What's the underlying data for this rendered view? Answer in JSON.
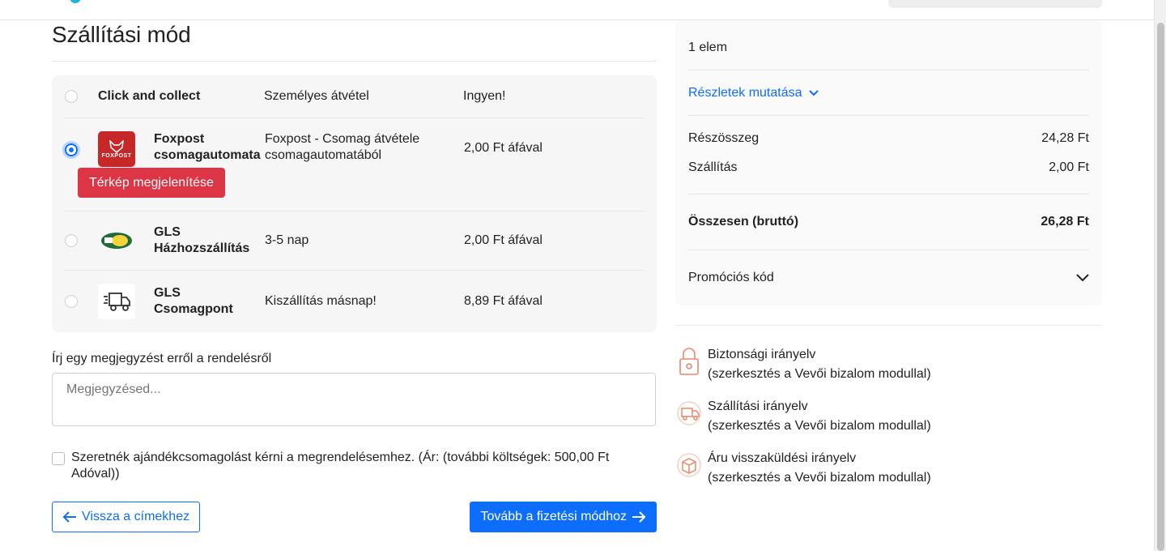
{
  "page": {
    "title": "Szállítási mód"
  },
  "methods": [
    {
      "name": "Click and collect",
      "description": "Személyes átvétel",
      "price": "Ingyen!",
      "selected": false,
      "icon": "none"
    },
    {
      "name_line1": "Foxpost",
      "name_line2": "csomagautomata",
      "description_line1": "Foxpost - Csomag átvétele",
      "description_line2": "csomagautomatából",
      "price": "2,00 Ft áfával",
      "selected": true,
      "icon": "foxpost-logo",
      "logo_text": "FOXPOST",
      "map_button": "Térkép megjelenítése"
    },
    {
      "name_line1": "GLS",
      "name_line2": "Házhozszállítás",
      "description": "3-5 nap",
      "price": "2,00 Ft áfával",
      "selected": false,
      "icon": "gls-logo"
    },
    {
      "name_line1": "GLS",
      "name_line2": "Csomagpont",
      "description": "Kiszállítás másnap!",
      "price": "8,89 Ft áfával",
      "selected": false,
      "icon": "delivery-truck-icon"
    }
  ],
  "note": {
    "label": "Írj egy megjegyzést erről a rendelésről",
    "placeholder": "Megjegyzésed..."
  },
  "gift": {
    "text": "Szeretnék ajándékcsomagolást kérni a megrendelésemhez. (Ár: (további költségek: 500,00 Ft Adóval))",
    "checked": false
  },
  "actions": {
    "back": "Vissza a címekhez",
    "next": "Tovább a fizetési módhoz"
  },
  "summary": {
    "items_count": "1 elem",
    "details_link": "Részletek mutatása",
    "subtotal_label": "Részösszeg",
    "subtotal_value": "24,28 Ft",
    "shipping_label": "Szállítás",
    "shipping_value": "2,00 Ft",
    "total_label": "Összesen (bruttó)",
    "total_value": "26,28 Ft",
    "promo_label": "Promóciós kód"
  },
  "trust": [
    {
      "title": "Biztonsági irányelv",
      "subtitle": "(szerkesztés a Vevői bizalom modullal)",
      "icon": "lock-icon"
    },
    {
      "title": "Szállítási irányelv",
      "subtitle": "(szerkesztés a Vevői bizalom modullal)",
      "icon": "truck-icon"
    },
    {
      "title": "Áru visszaküldési irányelv",
      "subtitle": "(szerkesztés a Vevői bizalom modullal)",
      "icon": "return-box-icon"
    }
  ],
  "colors": {
    "primary": "#0d6efd",
    "danger": "#dc3545",
    "trust_icon": "#e8896a"
  }
}
